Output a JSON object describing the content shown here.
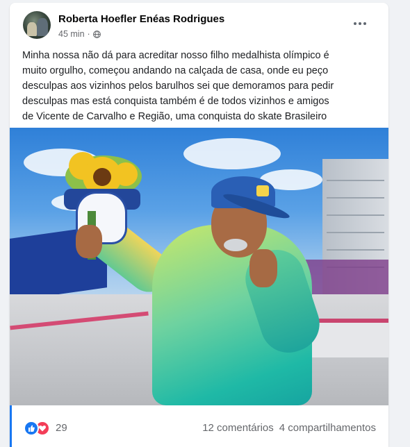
{
  "post": {
    "author": "Roberta Hoefler Enéas Rodrigues",
    "timestamp": "45 min",
    "separator": "·",
    "audience_icon": "globe-icon",
    "more_icon": "more-options-icon",
    "text_lines": [
      "Minha nossa não dá para acreditar nosso filho medalhista olímpico é",
      "muito orgulho, começou andando na calçada de casa, onde eu peço",
      "desculpas aos vizinhos pelos barulhos sei que demoramos para pedir",
      "desculpas mas está conquista também é de todos vizinhos e amigos",
      "de Vicente de Carvalho e Região, uma conquista do skate Brasileiro"
    ]
  },
  "footer": {
    "reaction_icons": [
      "like-icon",
      "love-icon"
    ],
    "reaction_count": "29",
    "comments": "12 comentários",
    "shares": "4 compartilhamentos"
  },
  "colors": {
    "facebook_blue": "#1877f2",
    "love_red": "#f33e58",
    "meta_gray": "#65676b"
  }
}
